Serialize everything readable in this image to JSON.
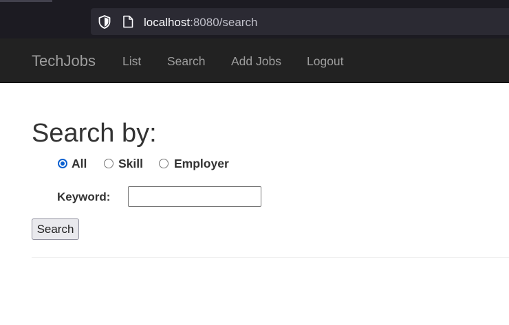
{
  "browser": {
    "url_host": "localhost",
    "url_rest": ":8080/search"
  },
  "navbar": {
    "brand": "TechJobs",
    "links": [
      "List",
      "Search",
      "Add Jobs",
      "Logout"
    ]
  },
  "search": {
    "title": "Search by:",
    "options": [
      "All",
      "Skill",
      "Employer"
    ],
    "selected_option": "All",
    "keyword_label": "Keyword:",
    "keyword_value": "",
    "submit_label": "Search"
  },
  "colors": {
    "navbar_bg": "#222222",
    "nav_text": "#9d9d9d",
    "radio_accent": "#0b60d0"
  },
  "icons": [
    "shield-icon",
    "page-icon"
  ]
}
